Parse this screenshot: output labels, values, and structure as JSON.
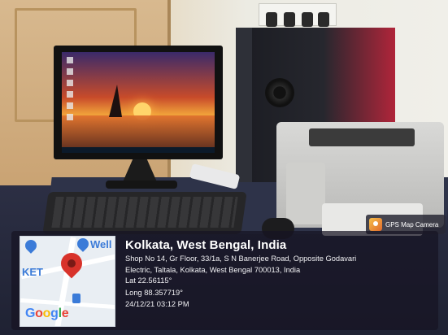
{
  "map": {
    "labels": {
      "ket": "KET",
      "well": "Well"
    },
    "logo": [
      "G",
      "o",
      "o",
      "g",
      "l",
      "e"
    ]
  },
  "location": {
    "city": "Kolkata, West Bengal, India",
    "address_line1": "Shop No 14, Gr Floor, 33/1a, S N Banerjee Road, Opposite Godavari",
    "address_line2": "Electric, Taltala, Kolkata, West Bengal 700013, India",
    "lat": "Lat 22.56115°",
    "long": "Long 88.357719°",
    "datetime": "24/12/21 03:12 PM"
  },
  "badge": {
    "label": "GPS Map Camera"
  },
  "colors": {
    "overlay": "#16142280",
    "pin": "#d8322a",
    "map_poi": "#3b7bd8"
  }
}
